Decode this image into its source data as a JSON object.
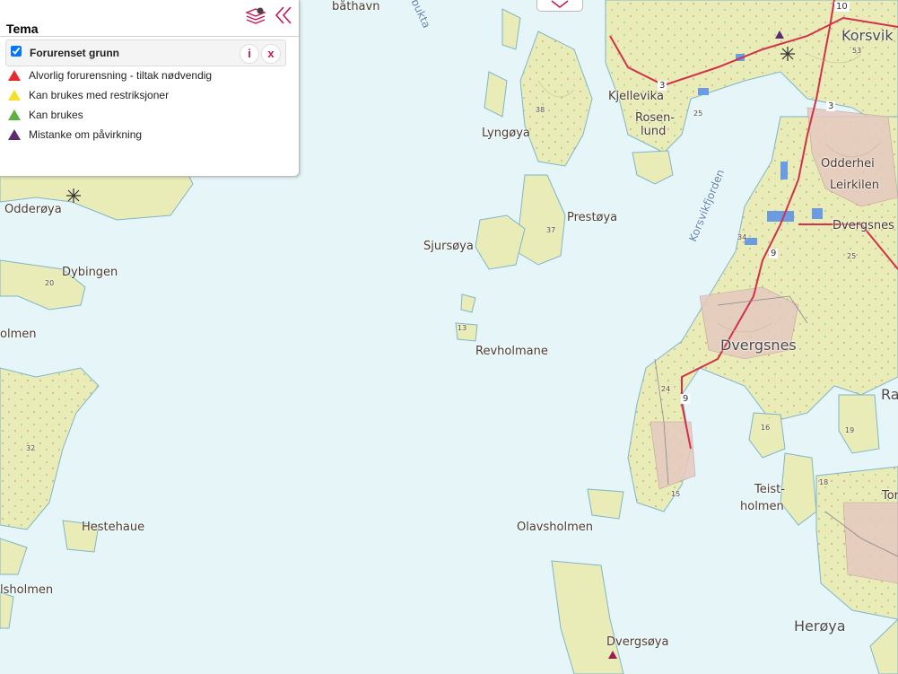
{
  "panel": {
    "title": "Tema",
    "layer": {
      "name": "Forurenset grunn",
      "checked": true,
      "info_label": "i",
      "remove_label": "x"
    },
    "legend": [
      {
        "label": "Alvorlig forurensning - tiltak nødvendig",
        "color": "#e52a2a"
      },
      {
        "label": "Kan brukes med restriksjoner",
        "color": "#f4e025"
      },
      {
        "label": "Kan brukes",
        "color": "#5eb13c"
      },
      {
        "label": "Mistanke om påvirkning",
        "color": "#5c2a6e"
      }
    ]
  },
  "map": {
    "places": {
      "bathavn": "båthavn",
      "bukta": "bukta",
      "korsvik": "Korsvik",
      "kjellevika": "Kjellevika",
      "rosen": "Rosen-",
      "lund": "lund",
      "lyngoya": "Lyngøya",
      "odderhei": "Odderhei",
      "leirkilen": "Leirkilen",
      "korsvikfjorden": "Korsvikfjorden",
      "oddeoya": "Odderøya",
      "prestoya": "Prestøya",
      "dvergsnes_small": "Dvergsnes",
      "sjursoya": "Sjursøya",
      "dybingen": "Dybingen",
      "revholmane": "Revholmane",
      "dvergsnes": "Dvergsnes",
      "olmen": "olmen",
      "ra": "Ra",
      "teist": "Teist-",
      "holmen": "holmen",
      "tor": "Tor",
      "hestehaue": "Hestehaue",
      "olavsholmen": "Olavsholmen",
      "lsholmen": "lsholmen",
      "heroya": "Herøya",
      "dvergsoya": "Dvergsøya"
    },
    "heights": {
      "h53": "53",
      "h25a": "25",
      "h38": "38",
      "h37": "37",
      "h34": "34",
      "h25b": "25",
      "h20": "20",
      "h13": "13",
      "h24": "24",
      "h16": "16",
      "h19": "19",
      "h32": "32",
      "h18": "18",
      "h15": "15"
    },
    "roads": {
      "r10": "10",
      "r3a": "3",
      "r3b": "3",
      "r9a": "9",
      "r9b": "9"
    },
    "colors": {
      "water": "#e6f6f8",
      "land": "#e9ecb6",
      "shore": "#7fb6c8",
      "road": "#d3304a"
    }
  }
}
